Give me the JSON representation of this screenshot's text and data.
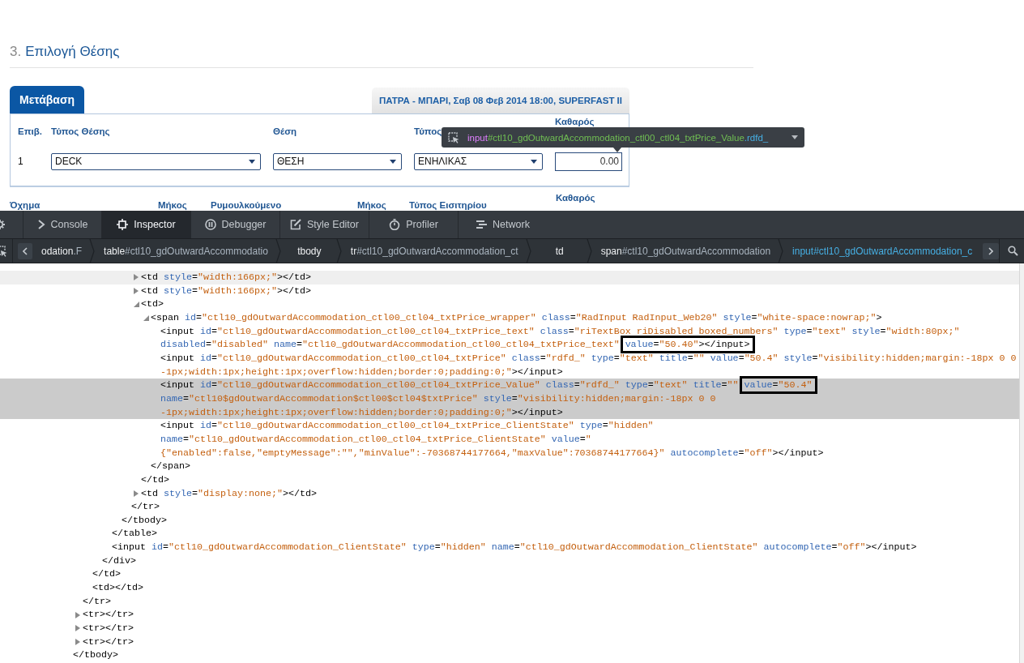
{
  "page": {
    "step_number": "3.",
    "title": "Επιλογή Θέσης"
  },
  "booking": {
    "tabs": [
      {
        "label": "Μετάβαση",
        "selected": true
      }
    ],
    "trip_header": "ΠΑΤΡΑ - ΜΠΑΡΙ, Σαβ 08 Φεβ 2014 18:00, SUPERFAST II",
    "seat_table": {
      "columns": [
        "Επιβ.",
        "Τύπος Θέσης",
        "Θέση",
        "Τύπος",
        "Καθαρός"
      ],
      "rows": [
        {
          "passenger": "1",
          "seat_type": "DECK",
          "seat": "ΘΕΣΗ",
          "passenger_type": "ΕΝΗΛΙΚΑΣ",
          "net_fare": "0.00"
        }
      ]
    },
    "vehicle_table": {
      "columns": [
        "Όχημα",
        "Μήκος",
        "Ρυμουλκούμενο",
        "Μήκος",
        "Τύπος Εισιτηρίου",
        "Καθαρός"
      ]
    }
  },
  "element_tooltip": {
    "selector": "input#ctl10_gdOutwardAccommodation_ctl00_ctl04_txtPrice_Value.rdfd_"
  },
  "devtools": {
    "tabs": [
      {
        "label": "Console",
        "kind": "console",
        "selected": false
      },
      {
        "label": "Inspector",
        "kind": "inspector",
        "selected": true
      },
      {
        "label": "Debugger",
        "kind": "debugger",
        "selected": false
      },
      {
        "label": "Style Editor",
        "kind": "style_editor",
        "selected": false
      },
      {
        "label": "Profiler",
        "kind": "profiler",
        "selected": false
      },
      {
        "label": "Network",
        "kind": "network",
        "selected": false
      }
    ],
    "breadcrumbs": [
      {
        "label": "odation.F",
        "selected": false
      },
      {
        "label": "table#ctl10_gdOutwardAccommodatio",
        "selected": false
      },
      {
        "label": "tbody",
        "selected": false
      },
      {
        "label": "tr#ctl10_gdOutwardAccommodation_ct",
        "selected": false
      },
      {
        "label": "td",
        "selected": false
      },
      {
        "label": "span#ctl10_gdOutwardAccommodation",
        "selected": false
      },
      {
        "label": "input#ctl10_gdOutwardAccommodation_c",
        "selected": true
      }
    ],
    "markup": [
      {
        "closing": "</tbody>",
        "children": [
          {
            "closing": "</tr>",
            "children": [
              {
                "closing": "</td>",
                "children": [
                  {
                    "closing": "</div>",
                    "children": [
                      {
                        "closing": "</table>",
                        "children": [
                          {
                            "closing": "</tbody>",
                            "children": [
                              {
                                "closing": "</tr>",
                                "children": [
                                  {
                                    "text": "<td style=\"width:166px;\"></td>",
                                    "kind": "parent",
                                    "expanded": false,
                                    "selected": false,
                                    "hovered": true
                                  },
                                  {
                                    "text": "<td style=\"width:166px;\"></td>",
                                    "kind": "parent",
                                    "expanded": false,
                                    "selected": false,
                                    "hovered": false
                                  },
                                  {
                                    "text": "<td>",
                                    "kind": "parent",
                                    "expanded": true,
                                    "selected": false,
                                    "hovered": false,
                                    "closing": "</td>",
                                    "children": [
                                      {
                                        "text": "<span id=\"ctl10_gdOutwardAccommodation_ctl00_ctl04_txtPrice_wrapper\" class=\"RadInput RadInput_Web20\" style=\"white-space:nowrap;\">",
                                        "kind": "parent",
                                        "expanded": true,
                                        "selected": false,
                                        "hovered": false,
                                        "closing": "</span>",
                                        "children": [
                                          {
                                            "segments": [
                                              {
                                                "text": "<input id=\"ctl10_gdOutwardAccommodation_ctl00_ctl04_txtPrice_text\" class=\"riTextBox riDisabled boxed_numbers\" type=\"text\" style=\"width:80px;\" disabled=\"disabled\" name=\"ctl10_gdOutwardAccommodation_ctl00_ctl04_txtPrice_text\" ",
                                                "boxed": false
                                              },
                                              {
                                                "text": "value=\"50.40\"></input>",
                                                "boxed": true
                                              }
                                            ],
                                            "kind": "leaf",
                                            "selected": false,
                                            "hovered": false
                                          },
                                          {
                                            "text": "<input id=\"ctl10_gdOutwardAccommodation_ctl00_ctl04_txtPrice\" class=\"rdfd_\" type=\"text\" title=\"\" value=\"50.4\" style=\"visibility:hidden;margin:-18px 0 0 -1px;width:1px;height:1px;overflow:hidden;border:0;padding:0;\"></input>",
                                            "kind": "leaf",
                                            "selected": false,
                                            "hovered": false
                                          },
                                          {
                                            "segments": [
                                              {
                                                "text": "<input id=\"ctl10_gdOutwardAccommodation_ctl00_ctl04_txtPrice_Value\" class=\"rdfd_\" type=\"text\" title=\"\" ",
                                                "boxed": false
                                              },
                                              {
                                                "text": "value=\"50.4\"",
                                                "boxed": true
                                              },
                                              {
                                                "text": " name=\"ctl10$gdOutwardAccommodation$ctl00$ctl04$txtPrice\" style=\"visibility:hidden;margin:-18px 0 0 -1px;width:1px;height:1px;overflow:hidden;border:0;padding:0;\"></input>",
                                                "boxed": false
                                              }
                                            ],
                                            "kind": "leaf",
                                            "selected": true,
                                            "hovered": false
                                          },
                                          {
                                            "text": "<input id=\"ctl10_gdOutwardAccommodation_ctl00_ctl04_txtPrice_ClientState\" type=\"hidden\" name=\"ctl10_gdOutwardAccommodation_ctl00_ctl04_txtPrice_ClientState\" value=\"{\"enabled\":false,\"emptyMessage\":\"\",\"minValue\":-70368744177664,\"maxValue\":70368744177664}\" autocomplete=\"off\"></input>",
                                            "kind": "leaf",
                                            "selected": false,
                                            "hovered": false
                                          }
                                        ]
                                      }
                                    ]
                                  },
                                  {
                                    "text": "<td style=\"display:none;\"></td>",
                                    "kind": "parent",
                                    "expanded": false,
                                    "selected": false,
                                    "hovered": false
                                  }
                                ]
                              }
                            ]
                          }
                        ]
                      },
                      {
                        "text": "<input id=\"ctl10_gdOutwardAccommodation_ClientState\" type=\"hidden\" name=\"ctl10_gdOutwardAccommodation_ClientState\" autocomplete=\"off\"></input>",
                        "kind": "leaf",
                        "selected": false,
                        "hovered": false
                      }
                    ]
                  }
                ]
              },
              {
                "text": "<td></td>",
                "kind": "leaf",
                "selected": false,
                "hovered": false
              }
            ]
          },
          {
            "text": "<tr></tr>",
            "kind": "parent",
            "expanded": false,
            "selected": false,
            "hovered": false
          },
          {
            "text": "<tr></tr>",
            "kind": "parent",
            "expanded": false,
            "selected": false,
            "hovered": false
          },
          {
            "text": "<tr></tr>",
            "kind": "parent",
            "expanded": false,
            "selected": false,
            "hovered": false
          }
        ]
      }
    ]
  }
}
